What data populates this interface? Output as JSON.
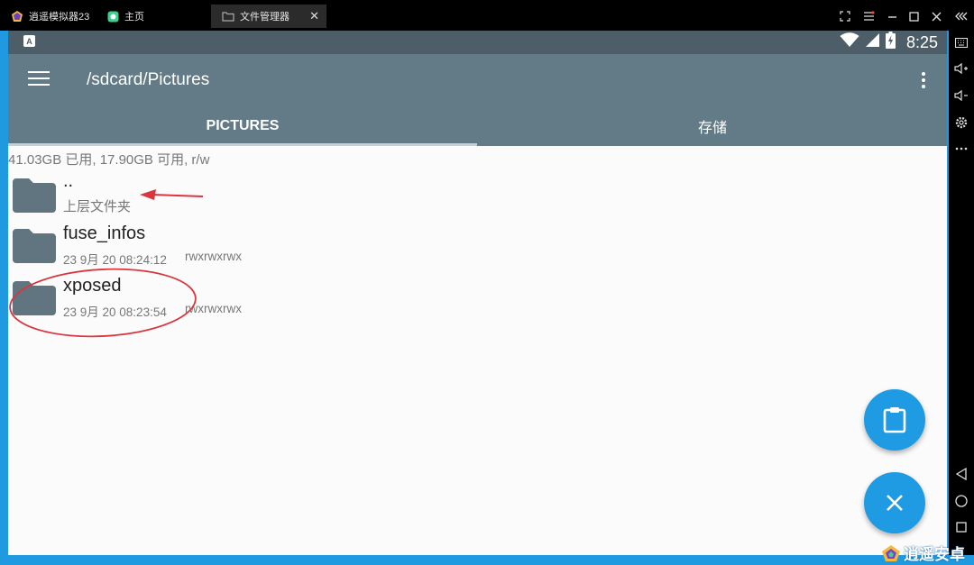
{
  "emulator": {
    "tabs": [
      {
        "label": "逍遥模拟器23",
        "icon": "app-logo-icon"
      },
      {
        "label": "主页",
        "icon": "home-icon"
      },
      {
        "label": "文件管理器",
        "icon": "file-manager-icon"
      }
    ],
    "watermark": "逍遥安卓"
  },
  "status_bar": {
    "badge": "A",
    "time": "8:25"
  },
  "toolbar": {
    "path": "/sdcard/Pictures"
  },
  "tabs": [
    {
      "label": "PICTURES"
    },
    {
      "label": "存储"
    }
  ],
  "storage_info": "41.03GB 已用, 17.90GB 可用, r/w",
  "files": [
    {
      "name": "..",
      "subtitle": "上层文件夹",
      "perms": ""
    },
    {
      "name": "fuse_infos",
      "subtitle": "23 9月 20 08:24:12",
      "perms": "rwxrwxrwx"
    },
    {
      "name": "xposed",
      "subtitle": "23 9月 20 08:23:54",
      "perms": "rwxrwxrwx"
    }
  ],
  "colors": {
    "toolbar": "#627b86",
    "statusbar": "#4e5e68",
    "folder": "#607580",
    "fab": "#1e9be2",
    "annotation": "#d9363e"
  }
}
